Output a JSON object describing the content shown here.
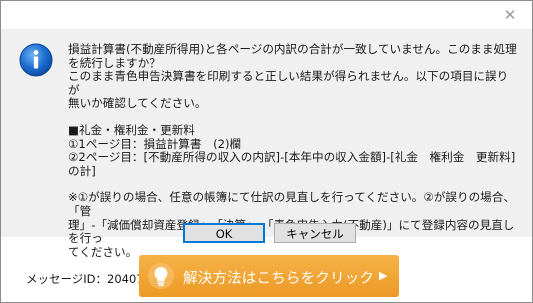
{
  "dialog": {
    "close_glyph": "✕",
    "message_lines": [
      "損益計算書(不動産所得用)と各ページの内訳の合計が一致していません。このまま処理",
      "を続行しますか？",
      "このまま青色申告決算書を印刷すると正しい結果が得られません。以下の項目に誤りが",
      "無いか確認してください。",
      "",
      "■礼金・権利金・更新料",
      "①1ページ目：損益計算書　(2)欄",
      "②2ページ目：[不動産所得の収入の内訳]-[本年中の収入金額]-[礼金　権利金　更新料]",
      "の計]",
      "",
      "※①が誤りの場合、任意の帳簿にて仕訳の見直しを行ってください。②が誤りの場合、「管",
      "理」-「減価償却資産登録」、「決算」-「青色申告入力(不動産)」にて登録内容の見直しを行っ",
      "てください。"
    ],
    "ok_label": "OK",
    "cancel_label": "キャンセル",
    "message_id": "メッセージID：20407",
    "solution_label": "解決方法はこちらをクリック",
    "solution_arrow": "▶",
    "colors": {
      "content_bg": "#f0f0f0",
      "info_blue": "#1f6fd1",
      "solution_orange": "#ef9f2b"
    }
  }
}
